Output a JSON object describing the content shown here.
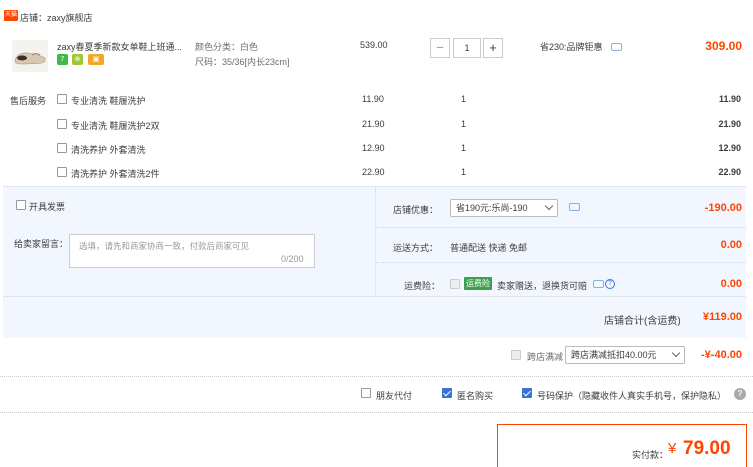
{
  "shop": {
    "tag": "天猫",
    "label": "店铺：zaxy旗舰店"
  },
  "item": {
    "title": "zaxy春夏季新款女单鞋上班通...",
    "color_spec": "颜色分类：白色",
    "size_spec": "尺码：35/36[内长23cm]",
    "unit_price": "539.00",
    "qty": "1",
    "promo": "省230:品牌钜惠",
    "subtotal": "309.00",
    "badges": [
      {
        "text": "7",
        "color": "#40b94b"
      },
      {
        "text": "⊕",
        "color": "#a0c830"
      },
      {
        "text": "▣",
        "color": "#f5a623"
      }
    ]
  },
  "after_sale": {
    "label": "售后服务",
    "services": [
      {
        "name": "专业清洗 鞋履洗护",
        "price": "11.90",
        "qty": "1",
        "total": "11.90"
      },
      {
        "name": "专业清洗 鞋履洗护2双",
        "price": "21.90",
        "qty": "1",
        "total": "21.90"
      },
      {
        "name": "清洗养护 外套清洗",
        "price": "12.90",
        "qty": "1",
        "total": "12.90"
      },
      {
        "name": "清洗养护 外套清洗2件",
        "price": "22.90",
        "qty": "1",
        "total": "22.90"
      }
    ]
  },
  "invoice": {
    "label": "开具发票"
  },
  "message": {
    "label": "给卖家留言：",
    "placeholder": "选填，请先和商家协商一致，付款后商家可见",
    "count": "0/200"
  },
  "discount": {
    "label": "店铺优惠：",
    "selected": "省190元:乐尚-190",
    "amount": "-190.00"
  },
  "shipping": {
    "label": "运送方式：",
    "value": "普通配送 快递 免邮",
    "amount": "0.00"
  },
  "insurance": {
    "label": "运费险：",
    "badge": "运费险",
    "value": "卖家赠送，退换货可赔",
    "amount": "0.00"
  },
  "shop_total": {
    "label": "店铺合计(含运费)",
    "amount": "¥119.00"
  },
  "cross_shop": {
    "label": "跨店满减",
    "selected": "跨店满减抵扣40.00元",
    "amount": "-¥-40.00"
  },
  "options": {
    "friend_pay": "朋友代付",
    "anonymous": "匿名购买",
    "phone_protect": "号码保护（隐藏收件人真实手机号，保护隐私）"
  },
  "payment": {
    "label": "实付款：",
    "currency": "¥",
    "amount": "79.00"
  },
  "colors": {
    "accent": "#ff4400",
    "panel": "#f2f7ff",
    "check": "#3a73d8"
  }
}
